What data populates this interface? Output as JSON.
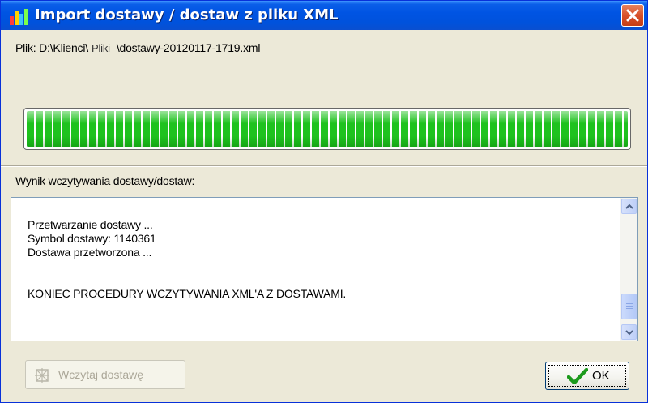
{
  "window": {
    "title": "Import dostawy / dostaw z pliku XML",
    "title_bar_color": "#0054e3",
    "close_icon": "close-icon"
  },
  "file": {
    "prefix": "Plik: D:\\Klienci\\",
    "middle": "Pliki",
    "suffix": "\\dostawy-20120117-1719.xml"
  },
  "progress": {
    "value_percent": 100,
    "color": "#1ec21e"
  },
  "result": {
    "label": "Wynik wczytywania dostawy/dostaw:",
    "lines": [
      "Przetwarzanie dostawy ...",
      "Symbol dostawy: 1140361",
      "Dostawa przetworzona ...",
      "",
      "",
      "KONIEC PROCEDURY WCZYTYWANIA XML'A Z DOSTAWAMI."
    ]
  },
  "buttons": {
    "load_label": "Wczytaj dostawę",
    "load_icon": "import-icon",
    "ok_label": "OK",
    "ok_icon": "checkmark-icon"
  }
}
